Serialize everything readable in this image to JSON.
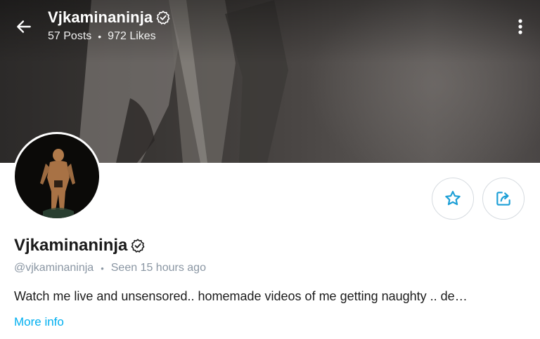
{
  "header": {
    "name": "Vjkaminaninja",
    "posts": "57 Posts",
    "likes": "972 Likes",
    "separator": "•"
  },
  "profile": {
    "display_name": "Vjkaminaninja",
    "handle": "@vjkaminaninja",
    "separator": "•",
    "seen": "Seen 15 hours ago",
    "bio": "Watch me live and unsensored.. homemade videos of me getting naughty .. de…",
    "more_info_label": "More info"
  },
  "icons": {
    "back": "arrow-left-icon",
    "more": "more-vertical-icon",
    "verified": "verified-badge-icon",
    "favorite": "star-icon",
    "share": "share-icon"
  },
  "colors": {
    "accent": "#00aff0",
    "muted": "#8a96a3",
    "text": "#1b1b1b",
    "icon_blue": "#1c9fd6"
  }
}
